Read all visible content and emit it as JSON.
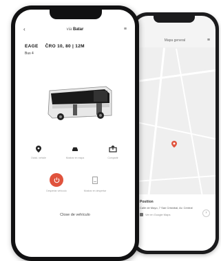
{
  "front": {
    "top_bar": {
      "brand_prefix": "via",
      "brand_name": "Batar"
    },
    "plate": "EAGE",
    "code": "ČRO 10, 80 | 12M",
    "subtitle": "Bus 4",
    "actions": [
      {
        "label": "Ovlád. vehicle",
        "icon": "location-pin-icon"
      },
      {
        "label": "Mostrar en mapa",
        "icon": "car-icon"
      },
      {
        "label": "Compartir",
        "icon": "share-icon"
      }
    ],
    "actions2": [
      {
        "label": "Despertar vehículo",
        "icon": "power-icon"
      },
      {
        "label": "Mostrar en despertar",
        "icon": "document-icon"
      }
    ],
    "close_label": "Close de vehículo"
  },
  "back": {
    "header_title": "Mapa general",
    "info_title": "Position",
    "address": "Calle de Mayo, 7 San Cristóbal, Av. Central",
    "link": "Ver en Google Maps"
  },
  "colors": {
    "accent": "#e0533d",
    "frame": "#111112",
    "map_bg": "#efefef"
  }
}
